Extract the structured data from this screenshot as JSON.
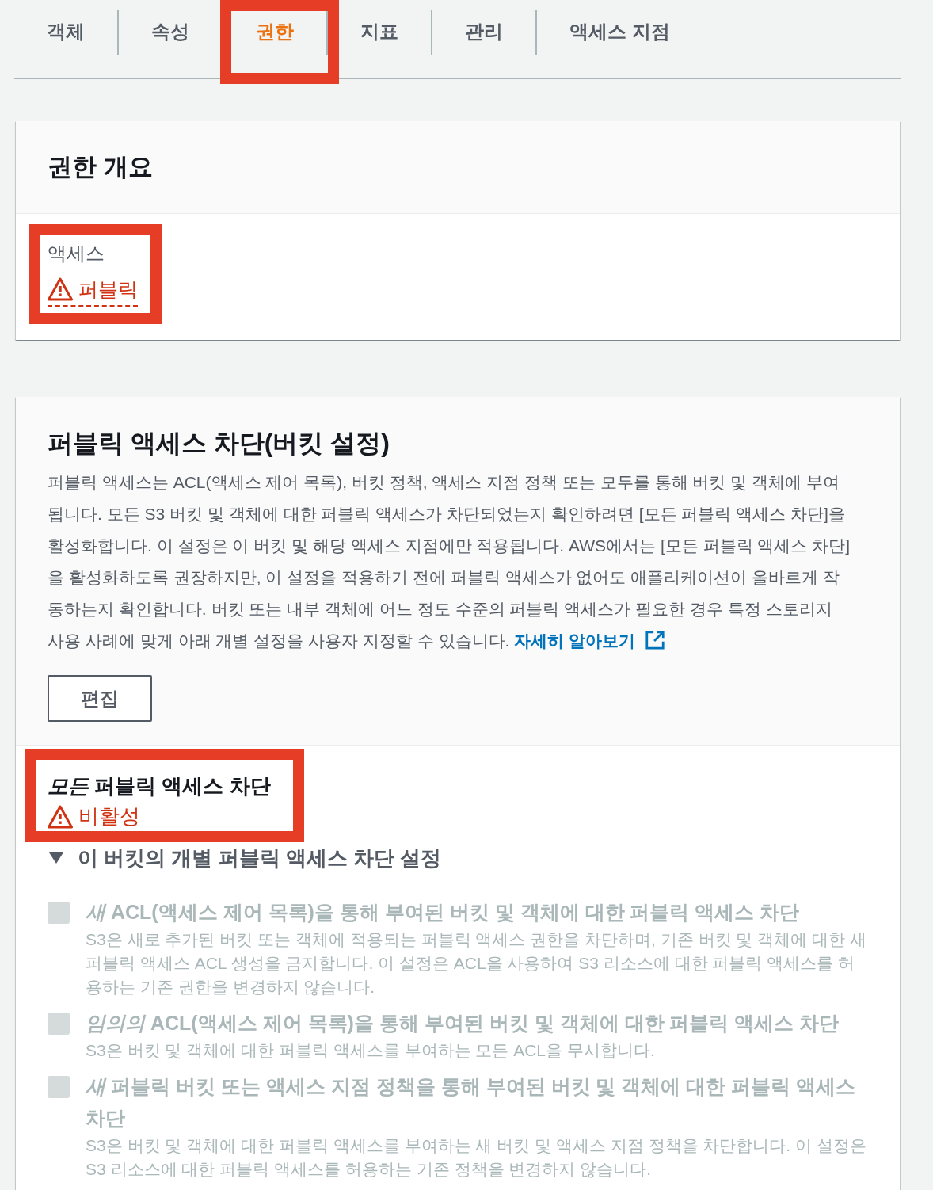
{
  "tabs": [
    {
      "label": "객체",
      "selected": false,
      "highlighted": false
    },
    {
      "label": "속성",
      "selected": false,
      "highlighted": false
    },
    {
      "label": "권한",
      "selected": true,
      "highlighted": true
    },
    {
      "label": "지표",
      "selected": false,
      "highlighted": false
    },
    {
      "label": "관리",
      "selected": false,
      "highlighted": false
    },
    {
      "label": "액세스 지점",
      "selected": false,
      "highlighted": false
    }
  ],
  "permissions_overview": {
    "title": "권한 개요",
    "access": {
      "label": "액세스",
      "value": "퍼블릭",
      "warning": true,
      "highlighted": true
    }
  },
  "block_public_access": {
    "title": "퍼블릭 액세스 차단(버킷 설정)",
    "description": "퍼블릭 액세스는 ACL(액세스 제어 목록), 버킷 정책, 액세스 지점 정책 또는 모두를 통해 버킷 및 객체에 부여됩니다. 모든 S3 버킷 및 객체에 대한 퍼블릭 액세스가 차단되었는지 확인하려면 [모든 퍼블릭 액세스 차단]을 활성화합니다. 이 설정은 이 버킷 및 해당 액세스 지점에만 적용됩니다. AWS에서는 [모든 퍼블릭 액세스 차단]을 활성화하도록 권장하지만, 이 설정을 적용하기 전에 퍼블릭 액세스가 없어도 애플리케이션이 올바르게 작동하는지 확인합니다. 버킷 또는 내부 객체에 어느 정도 수준의 퍼블릭 액세스가 필요한 경우 특정 스토리지 사용 사례에 맞게 아래 개별 설정을 사용자 지정할 수 있습니다.",
    "link": "자세히 알아보기",
    "edit_button": "편집",
    "block_all": {
      "label": "*모든* 퍼블릭 액세스 차단",
      "value": "비활성",
      "warning": true,
      "highlighted": true
    },
    "individual_settings": {
      "label": "이 버킷의 개별 퍼블릭 액세스 차단 설정",
      "expanded": true,
      "options": [
        {
          "title": "*새* ACL(액세스 제어 목록)을 통해 부여된 버킷 및 객체에 대한 퍼블릭 액세스 차단",
          "description": "S3은 새로 추가된 버킷 또는 객체에 적용되는 퍼블릭 액세스 권한을 차단하며, 기존 버킷 및 객체에 대한 새 퍼블릭 액세스 ACL 생성을 금지합니다. 이 설정은 ACL을 사용하여 S3 리소스에 대한 퍼블릭 액세스를 허용하는 기존 권한을 변경하지 않습니다.",
          "checked": false,
          "disabled": true
        },
        {
          "title": "*임의의* ACL(액세스 제어 목록)을 통해 부여된 버킷 및 객체에 대한 퍼블릭 액세스 차단",
          "description": "S3은 버킷 및 객체에 대한 퍼블릭 액세스를 부여하는 모든 ACL을 무시합니다.",
          "checked": false,
          "disabled": true
        },
        {
          "title": "*새* 퍼블릭 버킷 또는 액세스 지점 정책을 통해 부여된 버킷 및 객체에 대한 퍼블릭 액세스 차단",
          "description": "S3은 버킷 및 객체에 대한 퍼블릭 액세스를 부여하는 새 버킷 및 액세스 지점 정책을 차단합니다. 이 설정은 S3 리소스에 대한 퍼블릭 액세스를 허용하는 기존 정책을 변경하지 않습니다.",
          "checked": false,
          "disabled": true
        }
      ]
    }
  }
}
